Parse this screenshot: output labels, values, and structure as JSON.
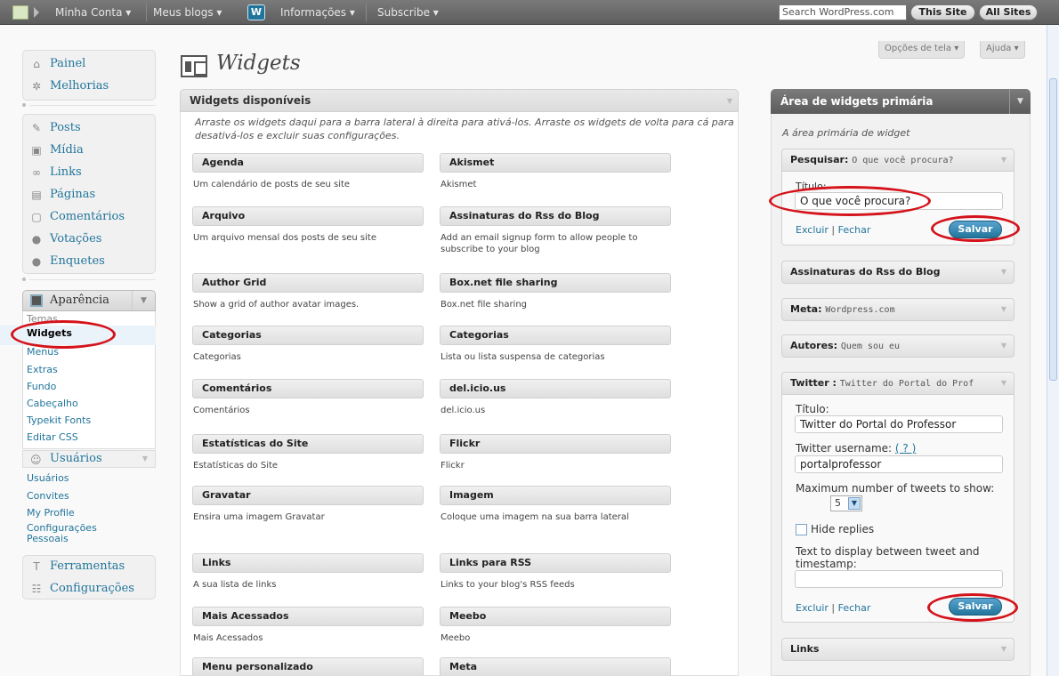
{
  "admin_bar": {
    "account": "Minha Conta",
    "blogs": "Meus blogs",
    "info": "Informações",
    "subscribe": "Subscribe",
    "wp_logo": "wordpress-logo",
    "search_placeholder": "Search WordPress.com",
    "this_site": "This Site",
    "all_sites": "All Sites"
  },
  "screen_options": "Opções de tela",
  "help": "Ajuda",
  "page_title": "Widgets",
  "menu": {
    "painel": "Painel",
    "melhorias": "Melhorias",
    "posts": "Posts",
    "midia": "Mídia",
    "links": "Links",
    "paginas": "Páginas",
    "comentarios": "Comentários",
    "votacoes": "Votações",
    "enquetes": "Enquetes",
    "aparencia": "Aparência",
    "aparencia_sub": [
      "Temas",
      "Widgets",
      "Menus",
      "Extras",
      "Fundo",
      "Cabeçalho",
      "Typekit Fonts",
      "Editar CSS"
    ],
    "usuarios": "Usuários",
    "usuarios_sub": [
      "Usuários",
      "Convites",
      "My Profile",
      "Configurações Pessoais"
    ],
    "ferramentas": "Ferramentas",
    "configuracoes": "Configurações"
  },
  "available": {
    "title": "Widgets disponíveis",
    "intro": "Arraste os widgets daqui para a barra lateral à direita para ativá-los. Arraste os widgets de volta para cá para desativá-los e excluir suas configurações.",
    "widgets": [
      {
        "name": "Agenda",
        "desc": "Um calendário de posts de seu site"
      },
      {
        "name": "Akismet",
        "desc": "Akismet"
      },
      {
        "name": "Arquivo",
        "desc": "Um arquivo mensal dos posts de seu site"
      },
      {
        "name": "Assinaturas do Rss do Blog",
        "desc": "Add an email signup form to allow people to subscribe to your blog"
      },
      {
        "name": "Author Grid",
        "desc": "Show a grid of author avatar images."
      },
      {
        "name": "Box.net file sharing",
        "desc": "Box.net file sharing"
      },
      {
        "name": "Categorias",
        "desc": "Categorias"
      },
      {
        "name": "Categorias",
        "desc": "Lista ou lista suspensa de categorias"
      },
      {
        "name": "Comentários",
        "desc": "Comentários"
      },
      {
        "name": "del.icio.us",
        "desc": "del.icio.us"
      },
      {
        "name": "Estatísticas do Site",
        "desc": "Estatísticas do Site"
      },
      {
        "name": "Flickr",
        "desc": "Flickr"
      },
      {
        "name": "Gravatar",
        "desc": "Ensira uma imagem Gravatar"
      },
      {
        "name": "Imagem",
        "desc": "Coloque uma imagem na sua barra lateral"
      },
      {
        "name": "Links",
        "desc": "A sua lista de links"
      },
      {
        "name": "Links para RSS",
        "desc": "Links to your blog's RSS feeds"
      },
      {
        "name": "Mais Acessados",
        "desc": "Mais Acessados"
      },
      {
        "name": "Meebo",
        "desc": "Meebo"
      },
      {
        "name": "Menu personalizado",
        "desc": ""
      },
      {
        "name": "Meta",
        "desc": ""
      }
    ]
  },
  "sidebar": {
    "title": "Área de widgets primária",
    "desc": "A área primária de widget",
    "search_widget": {
      "name": "Pesquisar",
      "sub": "O que você procura?",
      "title_label": "Título:",
      "title_value": "O que você procura?"
    },
    "delete": "Excluir",
    "close": "Fechar",
    "save": "Salvar",
    "rss_widget": "Assinaturas do Rss do Blog",
    "meta_widget": {
      "name": "Meta",
      "sub": "Wordpress.com"
    },
    "authors_widget": {
      "name": "Autores",
      "sub": "Quem sou eu"
    },
    "twitter_widget": {
      "name": "Twitter ",
      "sub": "Twitter do Portal do Prof",
      "title_label": "Título:",
      "title_value": "Twitter do Portal do Professor",
      "username_label": "Twitter username:",
      "help": "( ? )",
      "username_value": "portalprofessor",
      "max_label": "Maximum number of tweets to show:",
      "max_value": "5",
      "hide_replies": "Hide replies",
      "between_label": "Text to display between tweet and timestamp:",
      "between_value": ""
    },
    "links_widget": "Links"
  },
  "colors": {
    "accent": "#21759b",
    "annotation": "#d4131b"
  }
}
